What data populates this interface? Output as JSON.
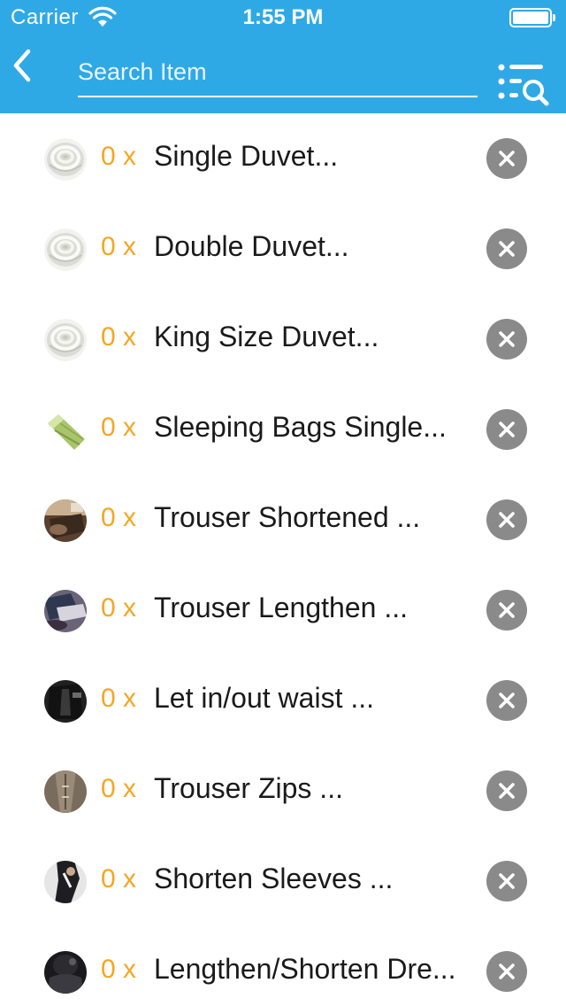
{
  "status_bar": {
    "carrier": "Carrier",
    "time": "1:55 PM"
  },
  "header": {
    "back_icon": "chevron-left-icon",
    "search_placeholder": "Search Item",
    "search_value": "",
    "filter_icon": "list-search-icon",
    "background_color": "#2fa9e6"
  },
  "colors": {
    "quantity": "#f5a623",
    "remove_button": "#8a8a8a"
  },
  "items": [
    {
      "quantity": "0 x",
      "name": "Single Duvet...",
      "thumb": "duvet"
    },
    {
      "quantity": "0 x",
      "name": "Double Duvet...",
      "thumb": "duvet"
    },
    {
      "quantity": "0 x",
      "name": "King Size Duvet...",
      "thumb": "duvet"
    },
    {
      "quantity": "0 x",
      "name": "Sleeping Bags Single...",
      "thumb": "sleeping-bag"
    },
    {
      "quantity": "0 x",
      "name": "Trouser Shortened ...",
      "thumb": "trouser-brown"
    },
    {
      "quantity": "0 x",
      "name": "Trouser Lengthen ...",
      "thumb": "trouser-blue"
    },
    {
      "quantity": "0 x",
      "name": "Let in/out waist ...",
      "thumb": "waist-black"
    },
    {
      "quantity": "0 x",
      "name": "Trouser Zips ...",
      "thumb": "zip-grey"
    },
    {
      "quantity": "0 x",
      "name": "Shorten Sleeves ...",
      "thumb": "sleeve-dark"
    },
    {
      "quantity": "0 x",
      "name": "Lengthen/Shorten Dre...",
      "thumb": "dress-dark"
    }
  ]
}
